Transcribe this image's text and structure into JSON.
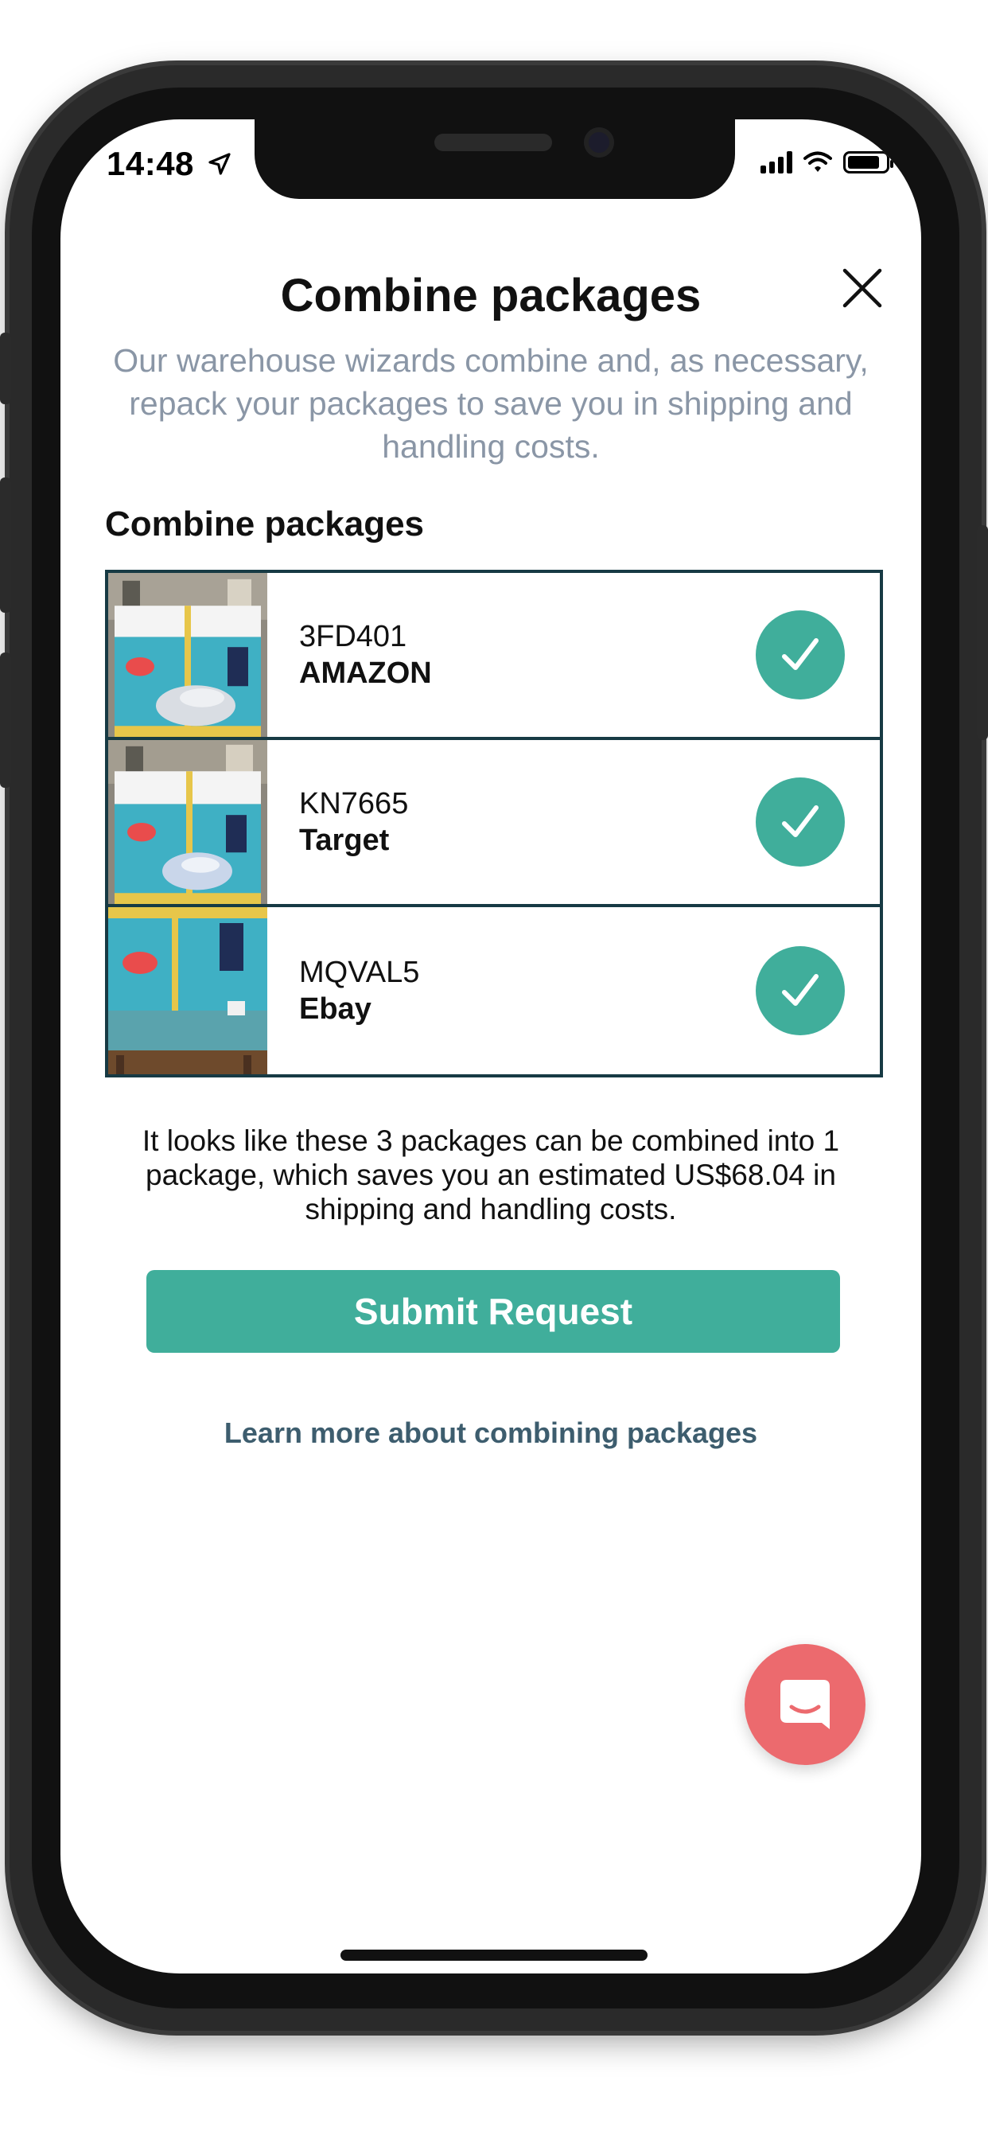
{
  "status_bar": {
    "time": "14:48",
    "location_icon": "location-arrow-icon",
    "signal_icon": "cellular-signal-icon",
    "wifi_icon": "wifi-icon",
    "battery_icon": "battery-icon",
    "battery_level": 0.85
  },
  "modal": {
    "title": "Combine packages",
    "subtitle": "Our warehouse wizards combine and, as necessary, repack your packages to save you in shipping and handling costs.",
    "close_icon": "close-icon"
  },
  "packages_section": {
    "title": "Combine packages",
    "items": [
      {
        "code": "3FD401",
        "store": "AMAZON",
        "selected": true
      },
      {
        "code": "KN7665",
        "store": "Target",
        "selected": true
      },
      {
        "code": "MQVAL5",
        "store": "Ebay",
        "selected": true
      }
    ]
  },
  "savings_text": "It looks like these 3 packages can be combined into 1 package, which saves you an estimated US$68.04 in shipping and handling costs.",
  "submit_label": "Submit Request",
  "learn_more_label": "Learn more about combining packages",
  "chat_icon": "chat-icon",
  "colors": {
    "accent": "#40ae9b",
    "border": "#173a44",
    "subtitle": "#8a96a6",
    "link": "#3d5d6e",
    "chat": "#ec6a6e"
  }
}
